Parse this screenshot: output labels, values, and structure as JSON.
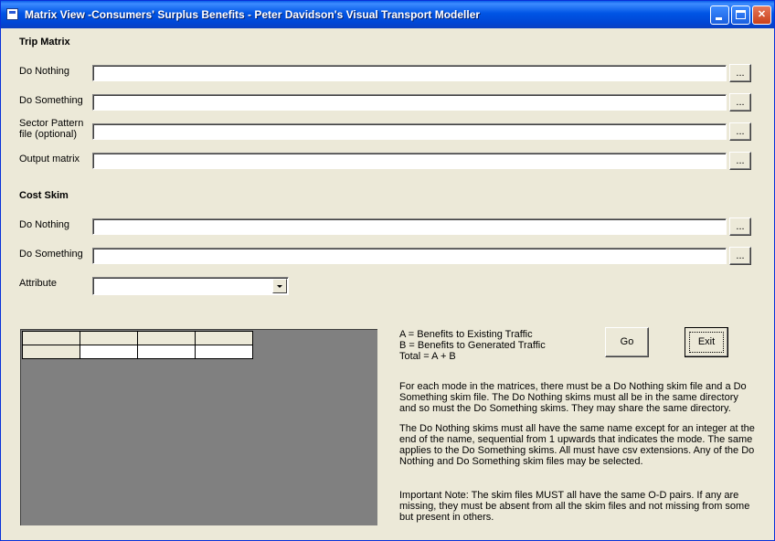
{
  "window": {
    "title": "Matrix View -Consumers' Surplus Benefits - Peter Davidson's Visual Transport Modeller",
    "buttons": {
      "minimize": "",
      "maximize": "",
      "close": "✕"
    }
  },
  "trip_matrix": {
    "title": "Trip Matrix",
    "do_nothing": {
      "label": "Do Nothing",
      "value": "",
      "browse": "..."
    },
    "do_something": {
      "label": "Do Something",
      "value": "",
      "browse": "..."
    },
    "sector_pattern": {
      "label_line1": "Sector Pattern",
      "label_line2": "file (optional)",
      "value": "",
      "browse": "..."
    },
    "output_matrix": {
      "label": "Output matrix",
      "value": "",
      "browse": "..."
    }
  },
  "cost_skim": {
    "title": "Cost Skim",
    "do_nothing": {
      "label": "Do Nothing",
      "value": "",
      "browse": "..."
    },
    "do_something": {
      "label": "Do Something",
      "value": "",
      "browse": "..."
    },
    "attribute": {
      "label": "Attribute",
      "value": ""
    }
  },
  "legend": {
    "line1": "A = Benefits to Existing Traffic",
    "line2": "B = Benefits to Generated Traffic",
    "line3": "Total = A + B"
  },
  "actions": {
    "go": "Go",
    "exit": "Exit"
  },
  "notes": {
    "para1": "For each mode in the matrices, there must be a Do Nothing skim file and a Do Something skim file.  The Do Nothing skims must all be in the same directory and so must the Do Something skims.  They may share the same directory.",
    "para2": "The Do Nothing skims must all have the same name except for an integer at the end of the name, sequential from 1 upwards that indicates the mode.  The same applies to the Do Something skims.  All must have csv extensions.   Any of the Do Nothing and  Do Something skim files may be selected.",
    "para3": "Important Note: The skim files MUST all have the same O-D pairs.  If any are missing, they must be absent from all the skim files and not missing from some but present in others."
  }
}
